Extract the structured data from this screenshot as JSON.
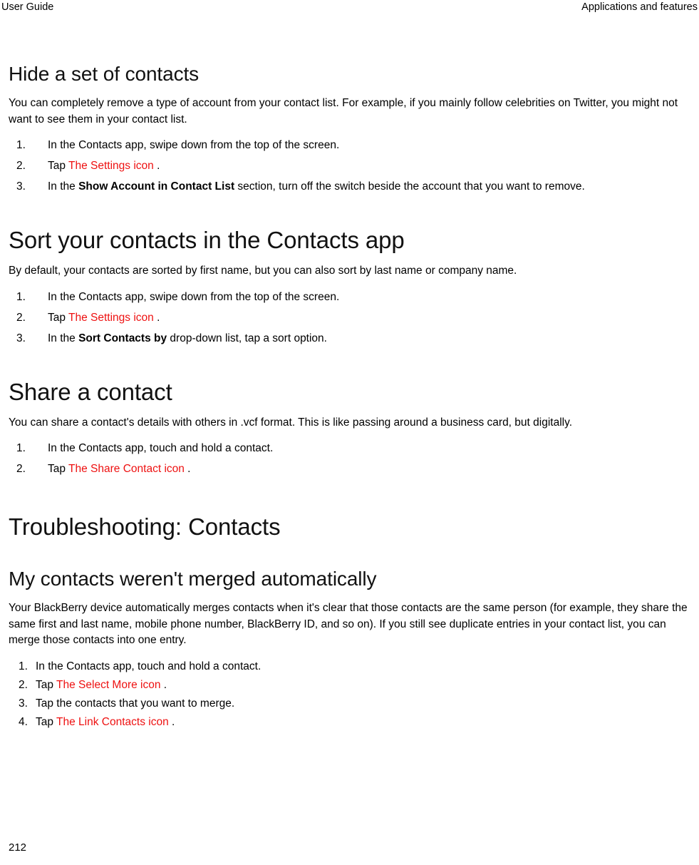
{
  "header": {
    "left": "User Guide",
    "right": "Applications and features"
  },
  "sections": [
    {
      "heading": "Hide a set of contacts",
      "heading_level": "h2",
      "paragraph": "You can completely remove a type of account from your contact list. For example, if you mainly follow celebrities on Twitter, you might not want to see them in your contact list.",
      "steps": [
        {
          "num": "1.",
          "pre": "In the Contacts app, swipe down from the top of the screen.",
          "alt": "",
          "bold": "",
          "post": ""
        },
        {
          "num": "2.",
          "pre": "Tap ",
          "alt": "The Settings icon",
          "bold": "",
          "post": " ."
        },
        {
          "num": "3.",
          "pre": "In the ",
          "alt": "",
          "bold": "Show Account in Contact List",
          "post": " section, turn off the switch beside the account that you want to remove."
        }
      ]
    },
    {
      "heading": "Sort your contacts in the Contacts app",
      "heading_level": "h1",
      "paragraph": "By default, your contacts are sorted by first name, but you can also sort by last name or company name.",
      "steps": [
        {
          "num": "1.",
          "pre": "In the Contacts app, swipe down from the top of the screen.",
          "alt": "",
          "bold": "",
          "post": ""
        },
        {
          "num": "2.",
          "pre": "Tap ",
          "alt": "The Settings icon",
          "bold": "",
          "post": " ."
        },
        {
          "num": "3.",
          "pre": "In the ",
          "alt": "",
          "bold": "Sort Contacts by",
          "post": " drop-down list, tap a sort option."
        }
      ]
    },
    {
      "heading": "Share a contact",
      "heading_level": "h1",
      "paragraph": "You can share a contact's details with others in .vcf format. This is like passing around a business card, but digitally.",
      "steps": [
        {
          "num": "1.",
          "pre": "In the Contacts app, touch and hold a contact.",
          "alt": "",
          "bold": "",
          "post": ""
        },
        {
          "num": "2.",
          "pre": "Tap ",
          "alt": "The Share Contact icon",
          "bold": "",
          "post": " ."
        }
      ]
    },
    {
      "heading": "Troubleshooting: Contacts",
      "heading_level": "h1",
      "paragraph": "",
      "steps": []
    },
    {
      "heading": "My contacts weren't merged automatically",
      "heading_level": "h2",
      "paragraph": "Your BlackBerry device automatically merges contacts when it's clear that those contacts are the same person (for example, they share the same first and last name, mobile phone number, BlackBerry ID, and so on). If you still see duplicate entries in your contact list, you can merge those contacts into one entry.",
      "steps": [
        {
          "num": "1.",
          "pre": "In the Contacts app, touch and hold a contact.",
          "alt": "",
          "bold": "",
          "post": ""
        },
        {
          "num": "2.",
          "pre": "Tap ",
          "alt": "The Select More icon",
          "bold": "",
          "post": " ."
        },
        {
          "num": "3.",
          "pre": "Tap the contacts that you want to merge.",
          "alt": "",
          "bold": "",
          "post": ""
        },
        {
          "num": "4.",
          "pre": "Tap ",
          "alt": "The Link Contacts icon",
          "bold": "",
          "post": " ."
        }
      ]
    }
  ],
  "footer": {
    "page_number": "212"
  },
  "colors": {
    "alt_text": "#ee1111",
    "body_text": "#000000",
    "background": "#ffffff"
  }
}
